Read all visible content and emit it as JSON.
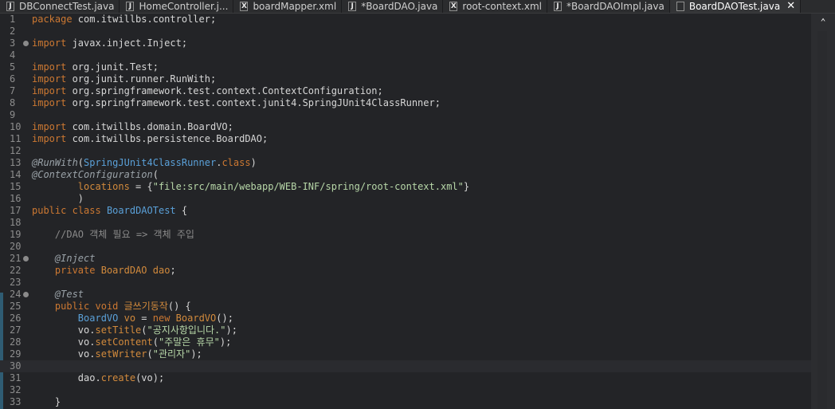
{
  "tabs": [
    {
      "label": "DBConnectTest.java",
      "icon": "java-file-icon",
      "glyph": "J"
    },
    {
      "label": "HomeController.j...",
      "icon": "java-file-icon",
      "glyph": "J"
    },
    {
      "label": "boardMapper.xml",
      "icon": "xml-file-icon",
      "glyph": "X"
    },
    {
      "label": "*BoardDAO.java",
      "icon": "java-file-icon",
      "glyph": "J"
    },
    {
      "label": "root-context.xml",
      "icon": "xml-file-icon",
      "glyph": "X"
    },
    {
      "label": "*BoardDAOImpl.java",
      "icon": "java-file-icon",
      "glyph": "J"
    },
    {
      "label": "BoardDAOTest.java",
      "icon": "java-file-icon",
      "glyph": "",
      "active": true,
      "close": "✕"
    }
  ],
  "editor": {
    "current_line": 30,
    "lines": [
      {
        "n": "1",
        "html": "<span class=\"kw\">package</span> com.itwillbs.controller;"
      },
      {
        "n": "2",
        "html": ""
      },
      {
        "n": "3",
        "fold": true,
        "html": "<span class=\"kw\">import</span> javax.inject.Inject;"
      },
      {
        "n": "4",
        "html": ""
      },
      {
        "n": "5",
        "html": "<span class=\"kw\">import</span> org.junit.Test;"
      },
      {
        "n": "6",
        "html": "<span class=\"kw\">import</span> org.junit.runner.RunWith;"
      },
      {
        "n": "7",
        "html": "<span class=\"kw\">import</span> org.springframework.test.context.ContextConfiguration;"
      },
      {
        "n": "8",
        "html": "<span class=\"kw\">import</span> org.springframework.test.context.junit4.SpringJUnit4ClassRunner;"
      },
      {
        "n": "9",
        "html": ""
      },
      {
        "n": "10",
        "html": "<span class=\"kw\">import</span> com.itwillbs.domain.BoardVO;"
      },
      {
        "n": "11",
        "html": "<span class=\"kw\">import</span> com.itwillbs.persistence.BoardDAO;"
      },
      {
        "n": "12",
        "html": ""
      },
      {
        "n": "13",
        "html": "<span class=\"ann\">@RunWith</span>(<span class=\"type\">SpringJUnit4ClassRunner</span>.<span class=\"kw\">class</span>)"
      },
      {
        "n": "14",
        "html": "<span class=\"ann\">@ContextConfiguration</span>("
      },
      {
        "n": "15",
        "html": "        <span class=\"fld\">locations</span> = {<span class=\"str\">\"file:src/main/webapp/WEB-INF/spring/root-context.xml\"</span>}"
      },
      {
        "n": "16",
        "html": "        )"
      },
      {
        "n": "17",
        "html": "<span class=\"kw\">public</span> <span class=\"kw\">class</span> <span class=\"type\">BoardDAOTest</span> {"
      },
      {
        "n": "18",
        "html": ""
      },
      {
        "n": "19",
        "html": "    <span class=\"cmt\">//DAO 객체 필요 =&gt; 객체 주입</span>"
      },
      {
        "n": "20",
        "html": ""
      },
      {
        "n": "21",
        "fold": true,
        "html": "    <span class=\"ann\">@Inject</span>"
      },
      {
        "n": "22",
        "html": "    <span class=\"kw\">private</span> <span class=\"fld\">BoardDAO</span> <span class=\"fld\">dao</span>;"
      },
      {
        "n": "23",
        "html": ""
      },
      {
        "n": "24",
        "fold": true,
        "html": "    <span class=\"ann\">@Test</span>"
      },
      {
        "n": "25",
        "html": "    <span class=\"kw\">public</span> <span class=\"kw\">void</span> <span class=\"fld\">글쓰기동작</span>() {"
      },
      {
        "n": "26",
        "html": "        <span class=\"type\">BoardVO</span> <span class=\"fld\">vo</span> = <span class=\"kw\">new</span> <span class=\"fld\">BoardVO</span>();"
      },
      {
        "n": "27",
        "html": "        vo.<span class=\"fld\">setTitle</span>(<span class=\"str\">\"공지사항입니다.\"</span>);"
      },
      {
        "n": "28",
        "html": "        vo.<span class=\"fld\">setContent</span>(<span class=\"str\">\"주말은 휴무\"</span>);"
      },
      {
        "n": "29",
        "html": "        vo.<span class=\"fld\">setWriter</span>(<span class=\"str\">\"관리자\"</span>);"
      },
      {
        "n": "30",
        "html": ""
      },
      {
        "n": "31",
        "html": "        dao.<span class=\"fld\">create</span>(vo);"
      },
      {
        "n": "32",
        "html": ""
      },
      {
        "n": "33",
        "html": "    }"
      }
    ]
  },
  "scrollbar": {
    "up_glyph": "⌃"
  }
}
